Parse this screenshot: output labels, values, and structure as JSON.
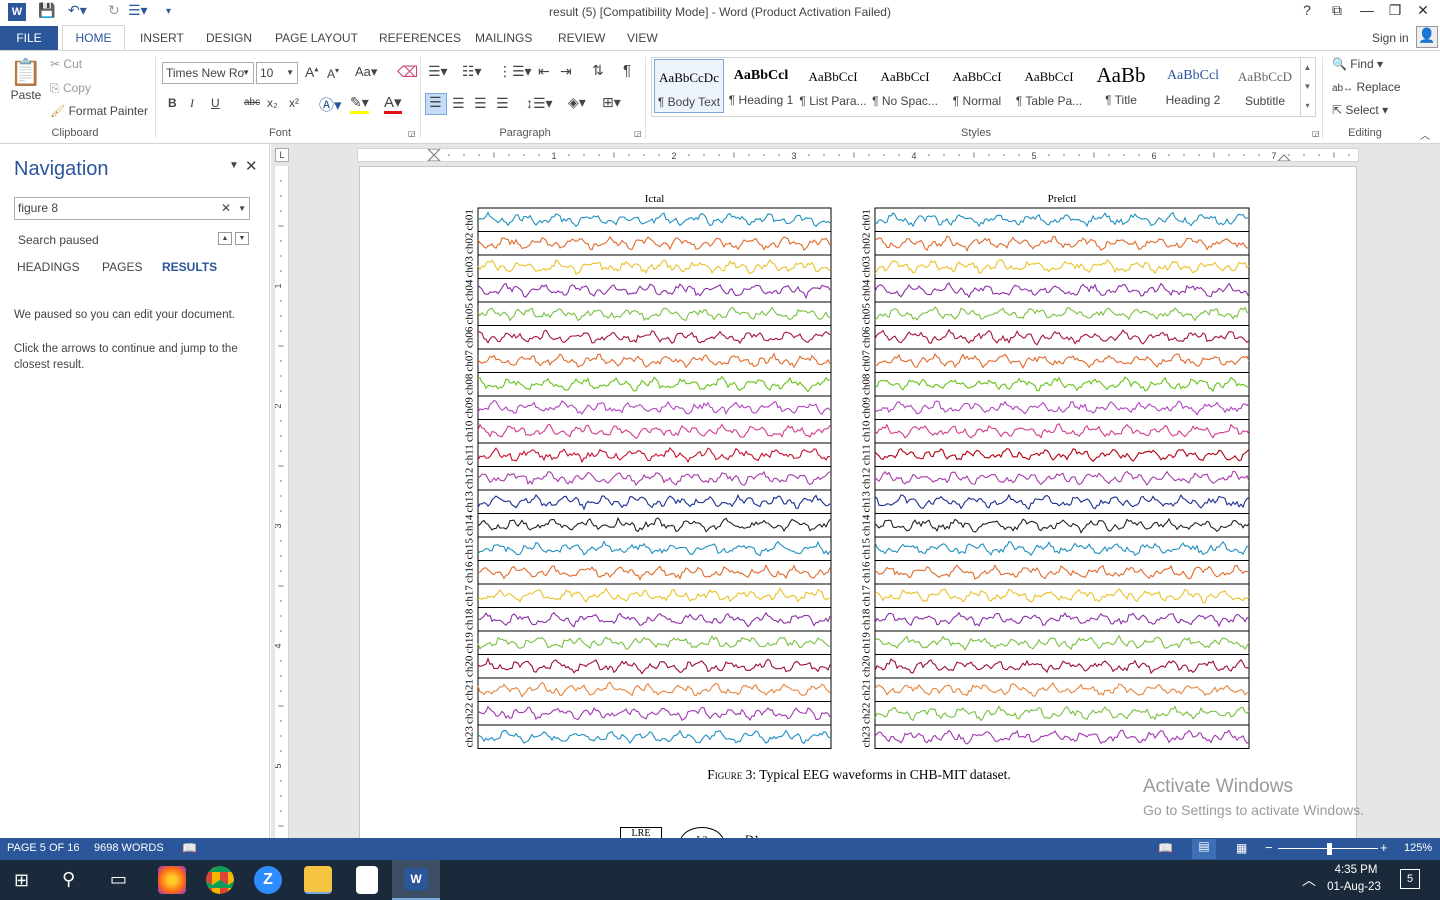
{
  "window": {
    "title": "result (5) [Compatibility Mode] - Word (Product Activation Failed)",
    "help": "?",
    "restore_ribbon": "⧉",
    "minimize": "—",
    "maximize": "❐",
    "close": "✕"
  },
  "tabs": [
    "FILE",
    "HOME",
    "INSERT",
    "DESIGN",
    "PAGE LAYOUT",
    "REFERENCES",
    "MAILINGS",
    "REVIEW",
    "VIEW"
  ],
  "sign_in": "Sign in",
  "clipboard": {
    "paste": "Paste",
    "cut": "Cut",
    "copy": "Copy",
    "format_painter": "Format Painter",
    "label": "Clipboard"
  },
  "font": {
    "name": "Times New Ro",
    "size": "10",
    "label": "Font",
    "grow": "A",
    "shrink": "A",
    "case": "Aa",
    "bold": "B",
    "italic": "I",
    "underline": "U",
    "strike": "abc",
    "sub": "x₂",
    "sup": "x²"
  },
  "paragraph": {
    "label": "Paragraph",
    "pilcrow": "¶"
  },
  "styles": {
    "label": "Styles",
    "items": [
      {
        "preview": "AaBbCcDc",
        "name": "¶ Body Text"
      },
      {
        "preview": "AaBbCcl",
        "name": "¶ Heading 1"
      },
      {
        "preview": "AaBbCcI",
        "name": "¶ List Para..."
      },
      {
        "preview": "AaBbCcI",
        "name": "¶ No Spac..."
      },
      {
        "preview": "AaBbCcI",
        "name": "¶ Normal"
      },
      {
        "preview": "AaBbCcI",
        "name": "¶ Table Pa..."
      },
      {
        "preview": "AaBb",
        "name": "¶ Title"
      },
      {
        "preview": "AaBbCcl",
        "name": "Heading 2"
      },
      {
        "preview": "AaBbCcD",
        "name": "Subtitle"
      }
    ]
  },
  "editing": {
    "label": "Editing",
    "find": "Find",
    "replace": "Replace",
    "select": "Select"
  },
  "navigation": {
    "title": "Navigation",
    "search_value": "figure 8",
    "status": "Search paused",
    "tabs": [
      "HEADINGS",
      "PAGES",
      "RESULTS"
    ],
    "msg1": "We paused so you can edit your document.",
    "msg2": "Click the arrows to continue and jump to the closest result."
  },
  "ruler": {
    "h": [
      "1",
      "2",
      "3",
      "4",
      "5",
      "6",
      "7"
    ],
    "v": [
      "1",
      "2",
      "3",
      "4",
      "5"
    ]
  },
  "figure": {
    "left_title": "Ictal",
    "right_title": "Prelctl",
    "channels": [
      "ch01",
      "ch02",
      "ch03",
      "ch04",
      "ch05",
      "ch06",
      "ch07",
      "ch08",
      "ch09",
      "ch10",
      "ch11",
      "ch12",
      "ch13",
      "ch14",
      "ch15",
      "ch16",
      "ch17",
      "ch18",
      "ch19",
      "ch20",
      "ch21",
      "ch22",
      "ch23"
    ],
    "colors_left": [
      "#1f8fbf",
      "#e06a2b",
      "#e8c22a",
      "#8a2fa8",
      "#79c043",
      "#a3163a",
      "#e06a2b",
      "#67c21a",
      "#b046c0",
      "#d23c8f",
      "#c8102e",
      "#a83aa8",
      "#1a2e8f",
      "#222222",
      "#1f8fbf",
      "#e06a2b",
      "#e8c22a",
      "#8a2fa8",
      "#79c043",
      "#9b0e3a",
      "#e6843b",
      "#a038b0",
      "#1f8fbf"
    ],
    "colors_right": [
      "#1f8fbf",
      "#e06a2b",
      "#e8c22a",
      "#8a2fa8",
      "#79c043",
      "#a3163a",
      "#e06a2b",
      "#67c21a",
      "#b046c0",
      "#d23c8f",
      "#b0000f",
      "#a83aa8",
      "#1a2e8f",
      "#222222",
      "#1f8fbf",
      "#e06a2b",
      "#e8c22a",
      "#8a2fa8",
      "#79c043",
      "#9b0e3a",
      "#e6843b",
      "#79c043",
      "#a038b0"
    ],
    "caption_prefix": "Figure 3:",
    "caption_text": "Typical EEG waveforms in CHB-MIT dataset."
  },
  "snippet": {
    "box": "LRE",
    "circle": "L2",
    "text": "D1"
  },
  "activate": {
    "line1": "Activate Windows",
    "line2": "Go to Settings to activate Windows."
  },
  "status": {
    "page": "PAGE 5 OF 16",
    "words": "9698 WORDS",
    "zoom": "125%"
  },
  "taskbar": {
    "time": "4:35 PM",
    "date": "01-Aug-23",
    "notif": "5"
  }
}
